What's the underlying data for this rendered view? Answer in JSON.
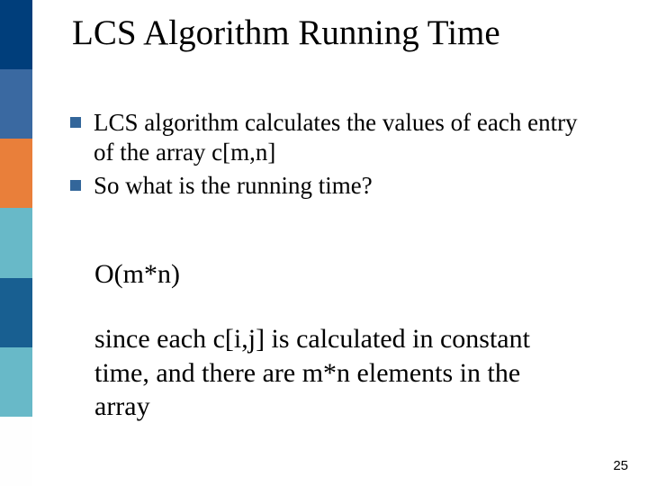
{
  "sidebar": {
    "colors": [
      "#003e7b",
      "#3a69a1",
      "#e97f3a",
      "#68b9c8",
      "#185f91",
      "#68b9c8",
      "#fefefe"
    ]
  },
  "title": "LCS Algorithm Running Time",
  "bullets": [
    {
      "text": "LCS algorithm calculates the values of each entry of the array c[m,n]"
    },
    {
      "text": "So what is the running time?"
    }
  ],
  "answer": "O(m*n)",
  "explanation": "since each c[i,j] is calculated in constant time, and there are m*n elements in the array",
  "page_number": "25"
}
